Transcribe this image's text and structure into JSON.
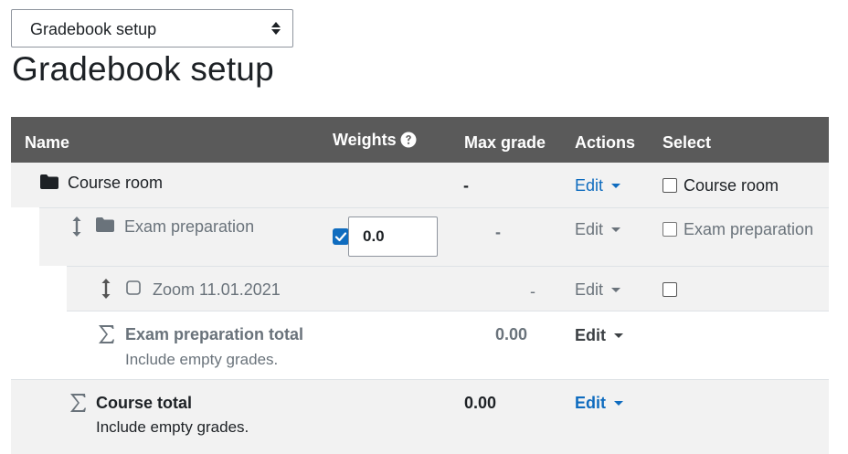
{
  "view_select": {
    "value": "Gradebook setup"
  },
  "page": {
    "title": "Gradebook setup"
  },
  "table": {
    "headers": {
      "name": "Name",
      "weights": "Weights",
      "max_grade": "Max grade",
      "actions": "Actions",
      "select": "Select"
    },
    "rows": [
      {
        "name": "Course room",
        "max_grade": "-",
        "action": "Edit",
        "select_label": "Course room"
      },
      {
        "name": "Exam preparation",
        "weight": "0.0",
        "max_grade": "-",
        "action": "Edit",
        "select_label": "Exam preparation"
      },
      {
        "name": "Zoom 11.01.2021",
        "max_grade": "-",
        "action": "Edit",
        "select_label": ""
      },
      {
        "name": "Exam preparation total",
        "sub": "Include empty grades.",
        "max_grade": "0.00",
        "action": "Edit"
      },
      {
        "name": "Course total",
        "sub": "Include empty grades.",
        "max_grade": "0.00",
        "action": "Edit"
      }
    ]
  },
  "icons": {
    "select_arrows": "sort-arrows-icon",
    "help": "question-circle-icon",
    "folder": "folder-icon",
    "move": "move-vertical-icon",
    "sigma": "sigma-icon"
  },
  "colors": {
    "header_bg": "#5a5a5a",
    "link": "#0f6cbf",
    "row_bg": "#f2f2f2",
    "muted": "#6a737b"
  }
}
